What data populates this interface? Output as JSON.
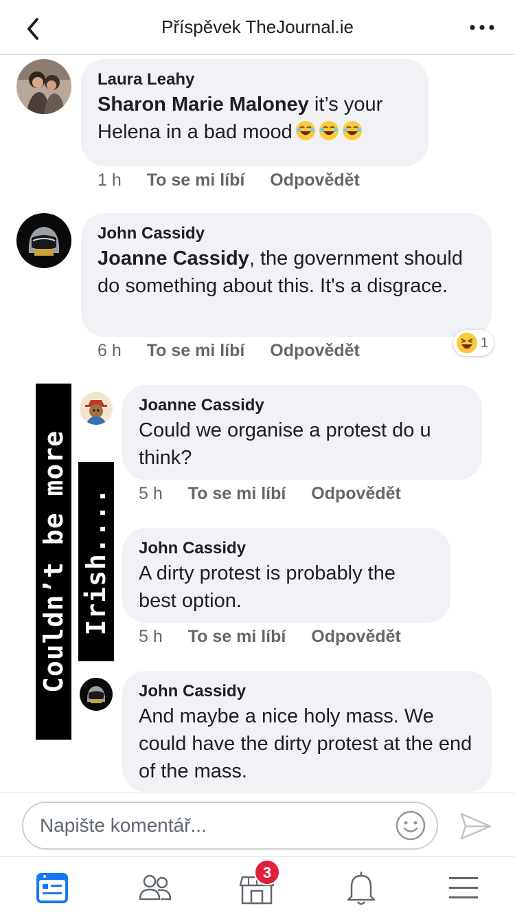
{
  "header": {
    "title": "Příspěvek TheJournal.ie"
  },
  "comments": [
    {
      "author": "Laura Leahy",
      "mention": "Sharon Marie Maloney",
      "text": " it’s your Helena in a bad mood",
      "time": "1 h",
      "like": "To se mi líbí",
      "reply": "Odpovědět"
    },
    {
      "author": "John Cassidy",
      "mention": "Joanne Cassidy",
      "text": ", the government should do something about this.  It's a disgrace.",
      "time": "6 h",
      "like": "To se mi líbí",
      "reply": "Odpovědět",
      "reaction_count": "1"
    }
  ],
  "replies": [
    {
      "author": "Joanne Cassidy",
      "text": "Could we organise a protest do u think?",
      "time": "5 h",
      "like": "To se mi líbí",
      "reply": "Odpovědět"
    },
    {
      "author": "John Cassidy",
      "text": "A dirty protest is probably the best option.",
      "time": "5 h",
      "like": "To se mi líbí",
      "reply": "Odpovědět"
    },
    {
      "author": "John Cassidy",
      "text": "And maybe a nice holy mass. We could have the dirty protest at the end of the mass."
    }
  ],
  "overlay": {
    "line1": "Couldn’t be more",
    "line2": "Irish...."
  },
  "composer": {
    "placeholder": "Napište komentář..."
  },
  "tabbar": {
    "marketplace_badge": "3"
  },
  "colors": {
    "accent": "#1877f2",
    "bubble": "#f0f2f5",
    "badge": "#e41e3f"
  }
}
